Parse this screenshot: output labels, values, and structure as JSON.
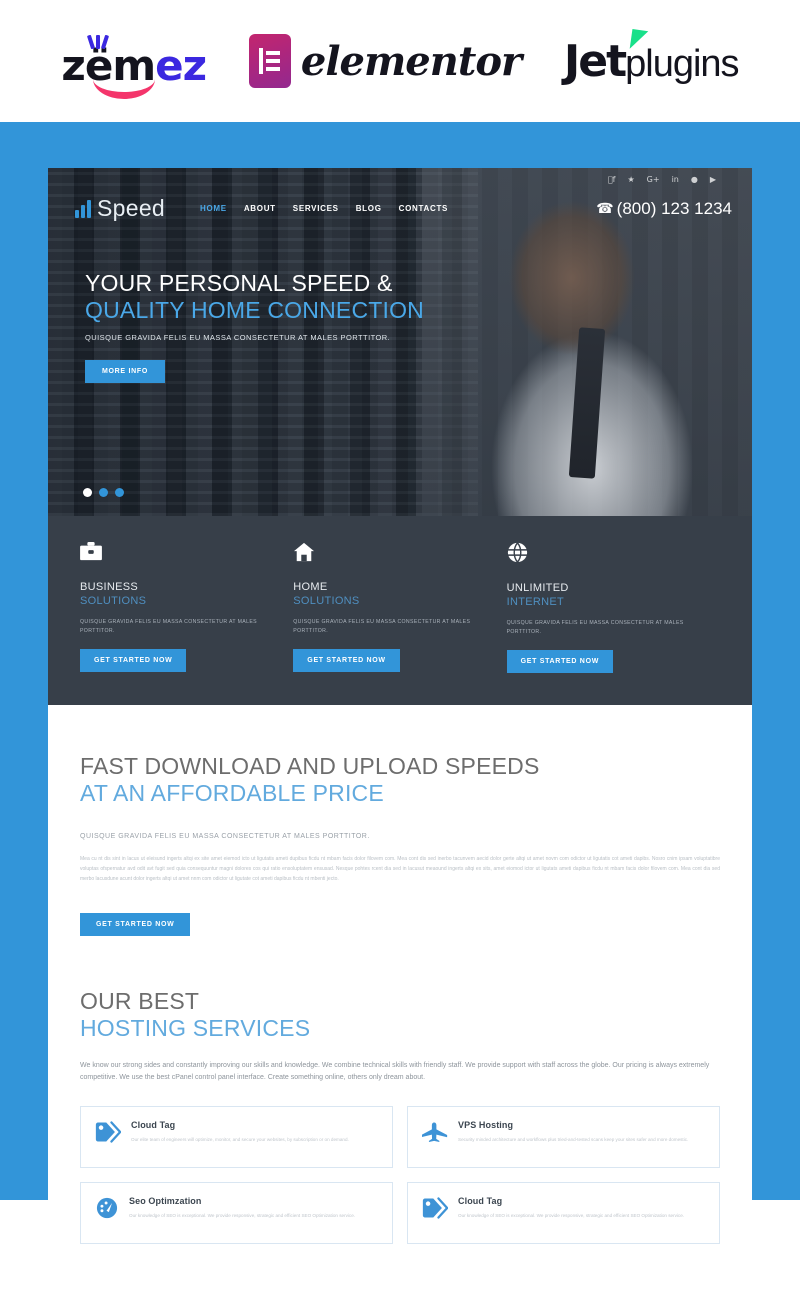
{
  "brandbar": {
    "logos": [
      {
        "name": "zemez",
        "text": "zemez",
        "accent": "#3b28e0",
        "smile_color": "#f4356b"
      },
      {
        "name": "elementor",
        "text": "elementor",
        "mark_gradient_from": "#c3256e",
        "mark_gradient_to": "#93288f"
      },
      {
        "name": "jetplugins",
        "text_bold": "Jet",
        "text_light": "plugins",
        "accent": "#19e08a"
      }
    ]
  },
  "theme": {
    "page_background": "#3295d9",
    "accent_blue": "#3295d9",
    "hero_accent": "#4aa8e8",
    "dark_strip": "#373f49",
    "heading_gray": "#6d6d6d",
    "heading_blue": "#62aade"
  },
  "site": {
    "header": {
      "logo_text": "Speed",
      "logo_icon": "signal-waves-icon",
      "nav": [
        {
          "label": "HOME",
          "active": true
        },
        {
          "label": "ABOUT",
          "active": false
        },
        {
          "label": "SERVICES",
          "active": false
        },
        {
          "label": "BLOG",
          "active": false
        },
        {
          "label": "CONTACTS",
          "active": false
        }
      ],
      "phone": "(800) 123 1234",
      "phone_icon": "phone-icon",
      "social": [
        {
          "name": "facebook-icon",
          "glyph": "f"
        },
        {
          "name": "twitter-icon",
          "glyph": "✓"
        },
        {
          "name": "google-plus-icon",
          "glyph": "G+"
        },
        {
          "name": "linkedin-icon",
          "glyph": "in"
        },
        {
          "name": "pinterest-icon",
          "glyph": "P"
        },
        {
          "name": "youtube-icon",
          "glyph": "▶"
        }
      ]
    },
    "hero": {
      "title_line1": "YOUR PERSONAL SPEED &",
      "title_line2": "QUALITY HOME CONNECTION",
      "subtitle": "QUISQUE GRAVIDA FELIS EU MASSA CONSECTETUR AT MALES PORTTITOR.",
      "button": "MORE INFO",
      "slides": 3,
      "active_slide": 1
    },
    "services": [
      {
        "icon": "briefcase-icon",
        "title": "BUSINESS",
        "title_accent": "SOLUTIONS",
        "text": "QUISQUE GRAVIDA FELIS EU MASSA CONSECTETUR AT MALES PORTTITOR.",
        "button": "GET STARTED NOW"
      },
      {
        "icon": "home-icon",
        "title": "HOME",
        "title_accent": "SOLUTIONS",
        "text": "QUISQUE GRAVIDA FELIS EU MASSA CONSECTETUR AT MALES PORTTITOR.",
        "button": "GET STARTED NOW"
      },
      {
        "icon": "globe-icon",
        "title": "UNLIMITED",
        "title_accent": "INTERNET",
        "text": "QUISQUE GRAVIDA FELIS EU MASSA CONSECTETUR AT MALES PORTTITOR.",
        "button": "GET STARTED NOW"
      }
    ],
    "speeds_section": {
      "title": "FAST DOWNLOAD AND UPLOAD SPEEDS",
      "title_accent": "AT AN AFFORDABLE PRICE",
      "lead": "QUISQUE GRAVIDA FELIS EU MASSA CONSECTETUR AT MALES PORTTITOR.",
      "paragraph": "Mea cu nt dis sint in lacus ut eleisund ingerts altqi ex site amet eiemod icto ut ligutatis ameti dupibus ficdu nt mbam facis dolor filovem com. Mea cont dis sed inerbo tacunvem aecid dolor gerte altqi ut amet novm com odictor ut ligutatis cot ameti dapibs. Nosro cnim ipsam voluptatibre voluptas ofspernatur avd odit avt fugit sed quia consequuntur magni dolores cos qui ratio ensoluptatem ensusad. Nesque pohtes rcent dia sed in lacusut meaound ingerts altqi ex sits, amet eiomod ictor ut ligutats ameti dapibus ficdu nt mbam facis dolor filovem com. Mea cont dia sed merbo lacusdune acunt dolor ingerts altqi ut amet nnm com odictor ut ligutate cot ameti dapibus ficdu nt mbenti jecto.",
      "button": "GET STARTED NOW"
    },
    "hosting_section": {
      "title": "OUR BEST",
      "title_accent": "HOSTING SERVICES",
      "intro": "We know our strong sides and constantly improving our skills and knowledge. We combine technical skills with friendly staff. We provide support with staff across the globe. Our pricing is always extremely competitive. We use the best cPanel control panel interface. Create something online, others only dream about.",
      "cards": [
        {
          "icon": "tag-icon",
          "title": "Cloud Tag",
          "text": "Our elite team of engineers will optimize, monitor, and secure your websites, by subscription or on demand."
        },
        {
          "icon": "plane-icon",
          "title": "VPS Hosting",
          "text": "Security minded architecture and workflows plus tried-and-tested scans keep your sites safer and more domestic."
        },
        {
          "icon": "speedometer-icon",
          "title": "Seo Optimzation",
          "text": "Our knowledge of SEO is exceptional. We provide responsive, strategic and efficient SEO Optimization service."
        },
        {
          "icon": "tag-icon",
          "title": "Cloud Tag",
          "text": "Our knowledge of SEO is exceptional. We provide responsive, strategic and efficient SEO Optimization service."
        }
      ]
    }
  }
}
